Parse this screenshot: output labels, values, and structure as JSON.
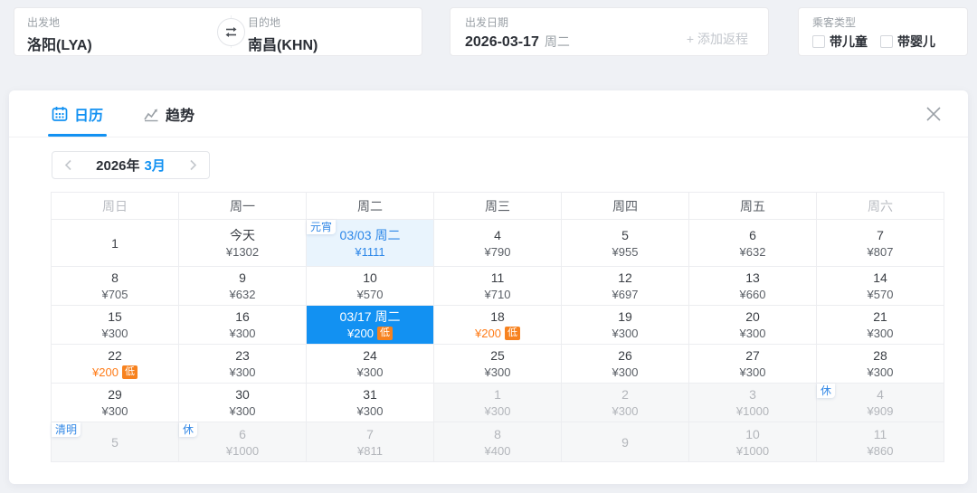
{
  "search_bar": {
    "departure": {
      "label": "出发地",
      "value": "洛阳(LYA)"
    },
    "destination": {
      "label": "目的地",
      "value": "南昌(KHN)"
    },
    "depart_date": {
      "label": "出发日期",
      "value": "2026-03-17",
      "weekday": "周二"
    },
    "add_return_label": "+ 添加返程",
    "passenger_type": {
      "label": "乘客类型",
      "options": [
        {
          "label": "带儿童",
          "checked": false
        },
        {
          "label": "带婴儿",
          "checked": false
        }
      ]
    }
  },
  "panel": {
    "tabs": [
      {
        "label": "日历",
        "icon": "calendar-icon",
        "active": true
      },
      {
        "label": "趋势",
        "icon": "trend-icon",
        "active": false
      }
    ],
    "month_nav": {
      "year": "2026年",
      "month": "3月"
    },
    "calendar": {
      "weekday_headers": [
        "周日",
        "周一",
        "周二",
        "周三",
        "周四",
        "周五",
        "周六"
      ],
      "low_badge_label": "低",
      "cells": [
        {
          "date": "1",
          "price": ""
        },
        {
          "date": "今天",
          "price": "¥1302"
        },
        {
          "date": "03/03 周二",
          "price": "¥1111",
          "type": "highlight",
          "badge": "元宵"
        },
        {
          "date": "4",
          "price": "¥790"
        },
        {
          "date": "5",
          "price": "¥955"
        },
        {
          "date": "6",
          "price": "¥632"
        },
        {
          "date": "7",
          "price": "¥807"
        },
        {
          "date": "8",
          "price": "¥705"
        },
        {
          "date": "9",
          "price": "¥632"
        },
        {
          "date": "10",
          "price": "¥570"
        },
        {
          "date": "11",
          "price": "¥710"
        },
        {
          "date": "12",
          "price": "¥697"
        },
        {
          "date": "13",
          "price": "¥660"
        },
        {
          "date": "14",
          "price": "¥570"
        },
        {
          "date": "15",
          "price": "¥300"
        },
        {
          "date": "16",
          "price": "¥300"
        },
        {
          "date": "03/17 周二",
          "price": "¥200",
          "type": "selected",
          "low": true
        },
        {
          "date": "18",
          "price": "¥200",
          "low": true
        },
        {
          "date": "19",
          "price": "¥300"
        },
        {
          "date": "20",
          "price": "¥300"
        },
        {
          "date": "21",
          "price": "¥300"
        },
        {
          "date": "22",
          "price": "¥200",
          "low": true
        },
        {
          "date": "23",
          "price": "¥300"
        },
        {
          "date": "24",
          "price": "¥300"
        },
        {
          "date": "25",
          "price": "¥300"
        },
        {
          "date": "26",
          "price": "¥300"
        },
        {
          "date": "27",
          "price": "¥300"
        },
        {
          "date": "28",
          "price": "¥300"
        },
        {
          "date": "29",
          "price": "¥300"
        },
        {
          "date": "30",
          "price": "¥300"
        },
        {
          "date": "31",
          "price": "¥300"
        },
        {
          "date": "1",
          "price": "¥300",
          "type": "next-month"
        },
        {
          "date": "2",
          "price": "¥300",
          "type": "next-month"
        },
        {
          "date": "3",
          "price": "¥1000",
          "type": "next-month"
        },
        {
          "date": "4",
          "price": "¥909",
          "type": "next-month",
          "badge": "休"
        },
        {
          "date": "5",
          "price": "",
          "type": "next-month",
          "badge": "清明"
        },
        {
          "date": "6",
          "price": "¥1000",
          "type": "next-month",
          "badge": "休"
        },
        {
          "date": "7",
          "price": "¥811",
          "type": "next-month"
        },
        {
          "date": "8",
          "price": "¥400",
          "type": "next-month"
        },
        {
          "date": "9",
          "price": "",
          "type": "next-month"
        },
        {
          "date": "10",
          "price": "¥1000",
          "type": "next-month"
        },
        {
          "date": "11",
          "price": "¥860",
          "type": "next-month"
        }
      ]
    }
  },
  "colors": {
    "page_bg": "#eff1f5",
    "accent_blue": "#1291f2",
    "highlight_cell_bg": "#e9f4fd",
    "highlight_cell_text": "#2d87e8",
    "selected_cell_bg": "#1291f2",
    "low_price_orange": "#ff7c19",
    "low_badge_bg": "#f7821f",
    "next_month_bg": "#f6f7f8"
  }
}
